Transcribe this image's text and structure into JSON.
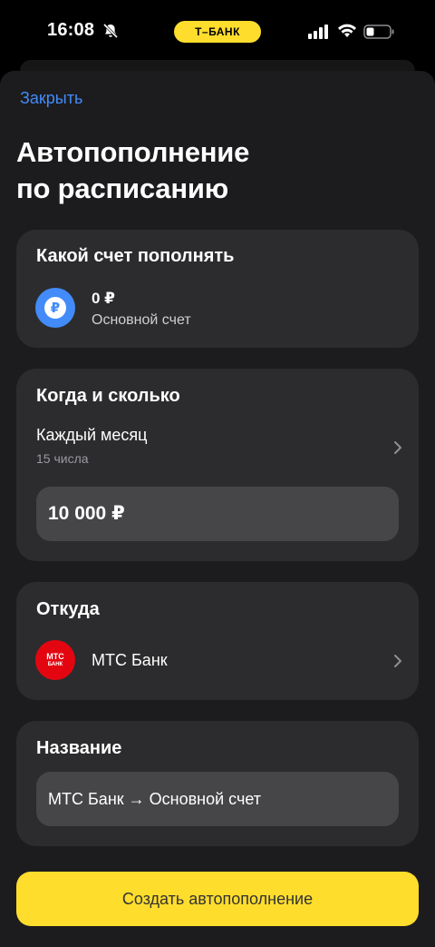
{
  "status_bar": {
    "time": "16:08",
    "bank_badge": "Т–БАНК",
    "icons": [
      "bell-slash-icon",
      "cellular-signal-icon",
      "wifi-icon",
      "battery-icon"
    ]
  },
  "header": {
    "close_label": "Закрыть",
    "title_line1": "Автопополнение",
    "title_line2": "по расписанию"
  },
  "account_card": {
    "title": "Какой счет пополнять",
    "icon": "ruble-icon",
    "icon_symbol": "₽",
    "balance": "0 ₽",
    "account_name": "Основной счет"
  },
  "schedule_card": {
    "title": "Когда и сколько",
    "frequency": "Каждый месяц",
    "day": "15 числа",
    "amount": "10 000 ₽"
  },
  "source_card": {
    "title": "Откуда",
    "bank_logo_line1": "МТС",
    "bank_logo_line2": "БАНК",
    "bank_name": "МТС Банк"
  },
  "name_card": {
    "title": "Название",
    "value": "МТС Банк → Основной счет"
  },
  "cta": {
    "label": "Создать автопополнение"
  },
  "colors": {
    "accent_yellow": "#ffdd2d",
    "link_blue": "#428bf9",
    "card_bg": "#2c2c2e",
    "sheet_bg": "#1c1c1e",
    "mts_red": "#e30611"
  }
}
